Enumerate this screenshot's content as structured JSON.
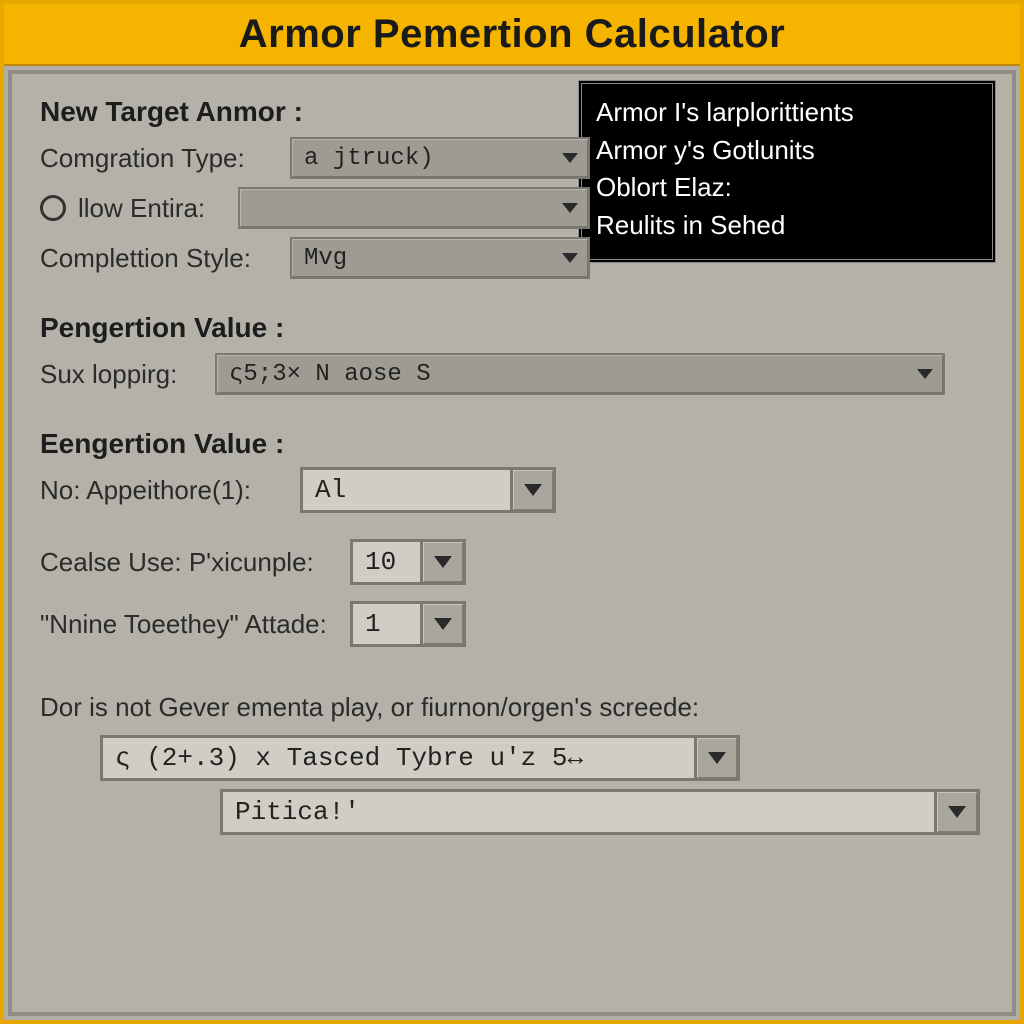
{
  "title": "Armor Pemertion Calculator",
  "infoPanel": {
    "line1": "Armor I's larplorittients",
    "line2": "Armor y's Gotlunits",
    "line3": "Oblort Elaz:",
    "line4": "Reulits in Sehed"
  },
  "section1": {
    "heading": "New Target Anmor :",
    "compTypeLabel": "Comgration Type:",
    "compTypeValue": "a  jtruck)",
    "lowEntiraLabel": "llow Entira:",
    "lowEntiraValue": "",
    "compStyleLabel": "Complettion Style:",
    "compStyleValue": "Mvg"
  },
  "section2": {
    "heading": "Pengertion Value :",
    "suxLabel": "Sux loppirg:",
    "suxValue": "ς5;3×   N aose S"
  },
  "section3": {
    "heading": "Eengertion Value :",
    "noAppLabel": "No: Appeithore(1):",
    "noAppValue": "Al",
    "cealseLabel": "Cealse Use: P'xicunple:",
    "cealseValue": "10",
    "nnineLabel": "\"Nnine Toeethey\" Attade:",
    "nnineValue": "1"
  },
  "footer": {
    "caption": "Dor is not Gever ementa play, or fiurnon/orgen's screede:",
    "dd1": "ς (2+.3) x Tasced Tybre u'z 5↔",
    "dd2": "Pitica!'"
  }
}
